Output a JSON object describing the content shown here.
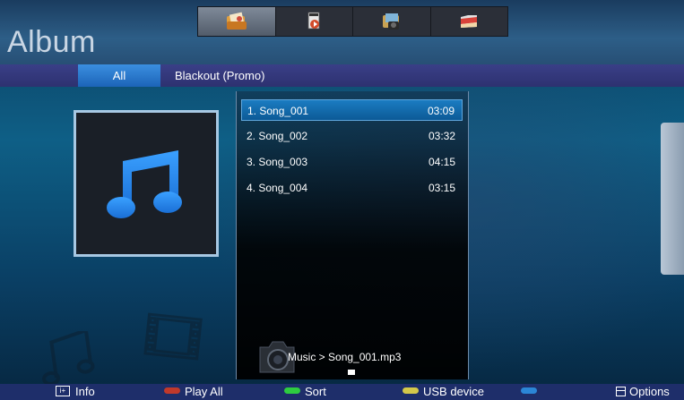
{
  "app": {
    "title": "Album"
  },
  "top_tabs": [
    {
      "name": "photo-tab",
      "icon": "photo-folder-icon",
      "active": true
    },
    {
      "name": "music-tab",
      "icon": "music-note-icon",
      "active": false
    },
    {
      "name": "video-tab",
      "icon": "camera-video-icon",
      "active": false
    },
    {
      "name": "file-tab",
      "icon": "folder-icon",
      "active": false
    }
  ],
  "filters": {
    "all": "All",
    "blackout": "Blackout (Promo)"
  },
  "songs": [
    {
      "label": "1. Song_001",
      "duration": "03:09",
      "selected": true
    },
    {
      "label": "2. Song_002",
      "duration": "03:32",
      "selected": false
    },
    {
      "label": "3. Song_003",
      "duration": "04:15",
      "selected": false
    },
    {
      "label": "4. Song_004",
      "duration": "03:15",
      "selected": false
    }
  ],
  "path": "Music > Song_001.mp3",
  "bottom": {
    "info": "Info",
    "info_key": "i+",
    "play_all": "Play All",
    "sort": "Sort",
    "usb": "USB device",
    "options": "Options"
  },
  "colors": {
    "red_key": "#c0392b",
    "green_key": "#2ecc40",
    "yellow_key": "#d4c84a",
    "blue_key": "#2b86d6",
    "accent": "#1c74c0"
  }
}
